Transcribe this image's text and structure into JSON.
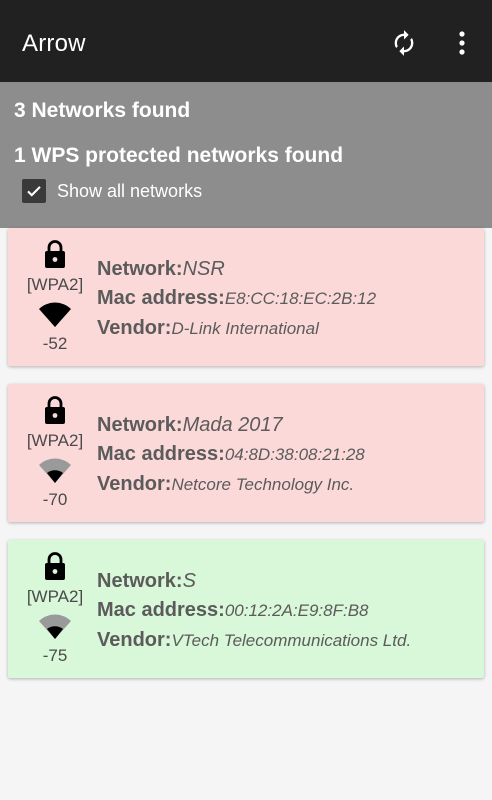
{
  "app": {
    "title": "Arrow"
  },
  "toolbar": {
    "refresh_icon": "refresh-icon",
    "overflow_icon": "overflow-menu-icon"
  },
  "summary": {
    "networks_found": "3 Networks found",
    "wps_found": "1 WPS protected networks found",
    "show_all_label": "Show all networks",
    "show_all_checked": true
  },
  "labels": {
    "network": "Network:",
    "mac": "Mac address:",
    "vendor": "Vendor:"
  },
  "colors": {
    "wps_card": "#fcd9d9",
    "normal_card": "#d9f7d9",
    "appbar": "#212121",
    "summary_bg": "#8d8d8d"
  },
  "networks": [
    {
      "security": "[WPA2]",
      "signal": "-52",
      "signal_level": 1.0,
      "network": "NSR",
      "mac": "E8:CC:18:EC:2B:12",
      "vendor": "D-Link International",
      "wps": true
    },
    {
      "security": "[WPA2]",
      "signal": "-70",
      "signal_level": 0.5,
      "network": "Mada 2017",
      "mac": "04:8D:38:08:21:28",
      "vendor": "Netcore Technology Inc.",
      "wps": true
    },
    {
      "security": "[WPA2]",
      "signal": "-75",
      "signal_level": 0.5,
      "network": "S",
      "mac": "00:12:2A:E9:8F:B8",
      "vendor": "VTech Telecommunications Ltd.",
      "wps": false
    }
  ]
}
